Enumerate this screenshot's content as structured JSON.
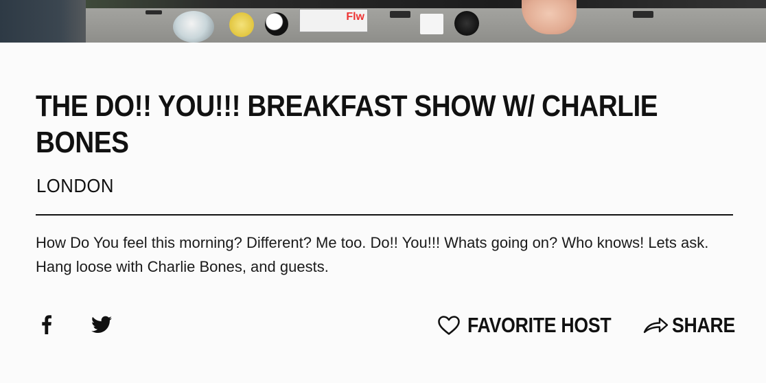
{
  "show": {
    "title": "THE DO!! YOU!!! BREAKFAST SHOW W/ CHARLIE BONES",
    "location": "LONDON",
    "description": "How Do You feel this morning? Different? Me too. Do!! You!!! Whats going on? Who knows! Lets ask. Hang loose with Charlie Bones, and guests."
  },
  "actions": {
    "favorite_label": "FAVORITE HOST",
    "share_label": "SHARE"
  },
  "social": {
    "icons": [
      "facebook-icon",
      "twitter-icon"
    ]
  },
  "hero": {
    "sticker_text": "Flw"
  },
  "colors": {
    "background": "#fbfbfb",
    "text": "#111111"
  }
}
